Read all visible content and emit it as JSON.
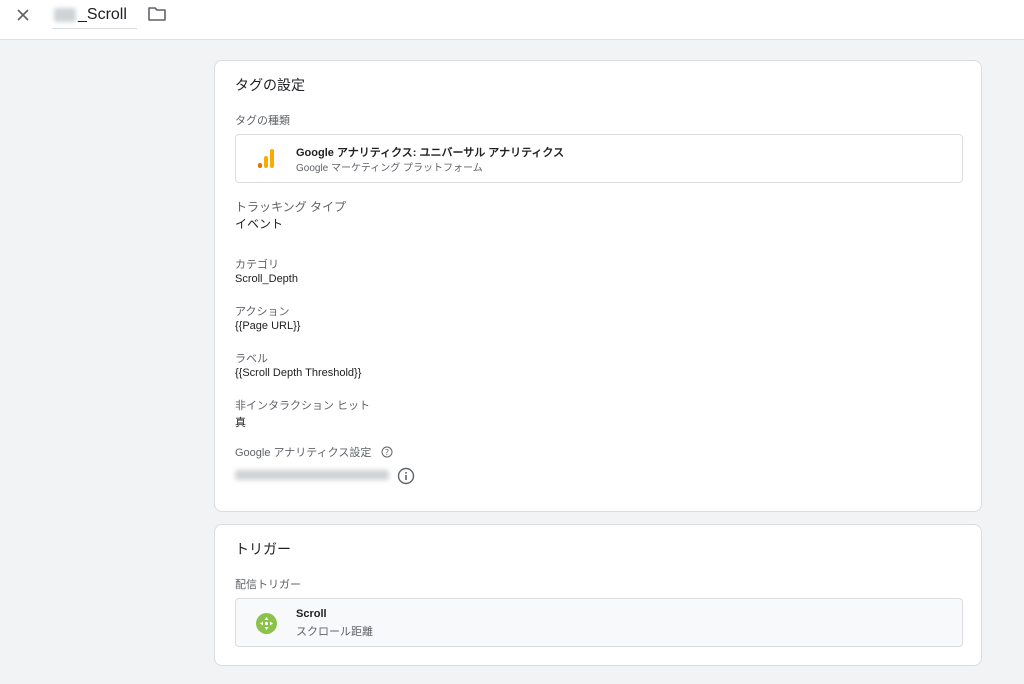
{
  "header": {
    "title": "_Scroll",
    "close_icon": "close-icon",
    "folder_icon": "folder-icon"
  },
  "tag_config": {
    "title": "タグの設定",
    "tag_type_label": "タグの種類",
    "tag_type_name": "Google アナリティクス: ユニバーサル アナリティクス",
    "tag_type_platform": "Google マーケティング プラットフォーム",
    "tracking_type_label": "トラッキング タイプ",
    "tracking_type_value": "イベント",
    "category_label": "カテゴリ",
    "category_value": "Scroll_Depth",
    "action_label": "アクション",
    "action_value": "{{Page URL}}",
    "label_label": "ラベル",
    "label_value": "{{Scroll Depth Threshold}}",
    "non_interaction_label": "非インタラクション ヒット",
    "non_interaction_value": "真",
    "ga_settings_label": "Google アナリティクス設定"
  },
  "trigger": {
    "title": "トリガー",
    "firing_label": "配信トリガー",
    "name": "Scroll",
    "type": "スクロール距離"
  },
  "colors": {
    "background": "#f1f3f4",
    "ga_orange": "#f9ab00",
    "ga_dark_orange": "#e37400",
    "trigger_green": "#8bc34a"
  }
}
